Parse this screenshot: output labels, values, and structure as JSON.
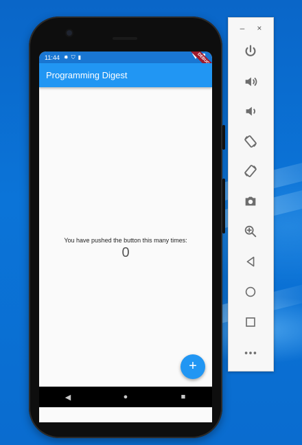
{
  "phone": {
    "status_bar": {
      "time": "11:44",
      "icons": [
        "gear-icon",
        "shield-icon",
        "sd-card-icon"
      ],
      "debug_banner": "DEBUG"
    },
    "app_bar": {
      "title": "Programming Digest"
    },
    "main": {
      "counter_label": "You have pushed the button this many times:",
      "counter_value": "0"
    },
    "fab": {
      "label": "+"
    },
    "nav": [
      "back-icon",
      "home-icon",
      "recents-icon"
    ]
  },
  "emulator_panel": {
    "window_controls": {
      "minimize": "–",
      "close": "×"
    },
    "tools": [
      "power-icon",
      "volume-up-icon",
      "volume-down-icon",
      "rotate-left-icon",
      "rotate-right-icon",
      "camera-icon",
      "zoom-icon",
      "back-icon",
      "home-icon",
      "overview-icon",
      "more-icon"
    ]
  },
  "colors": {
    "primary": "#2196f3",
    "status_bar": "#1976d2",
    "desktop": "#0b74d8",
    "debug_banner": "#a0192c"
  }
}
